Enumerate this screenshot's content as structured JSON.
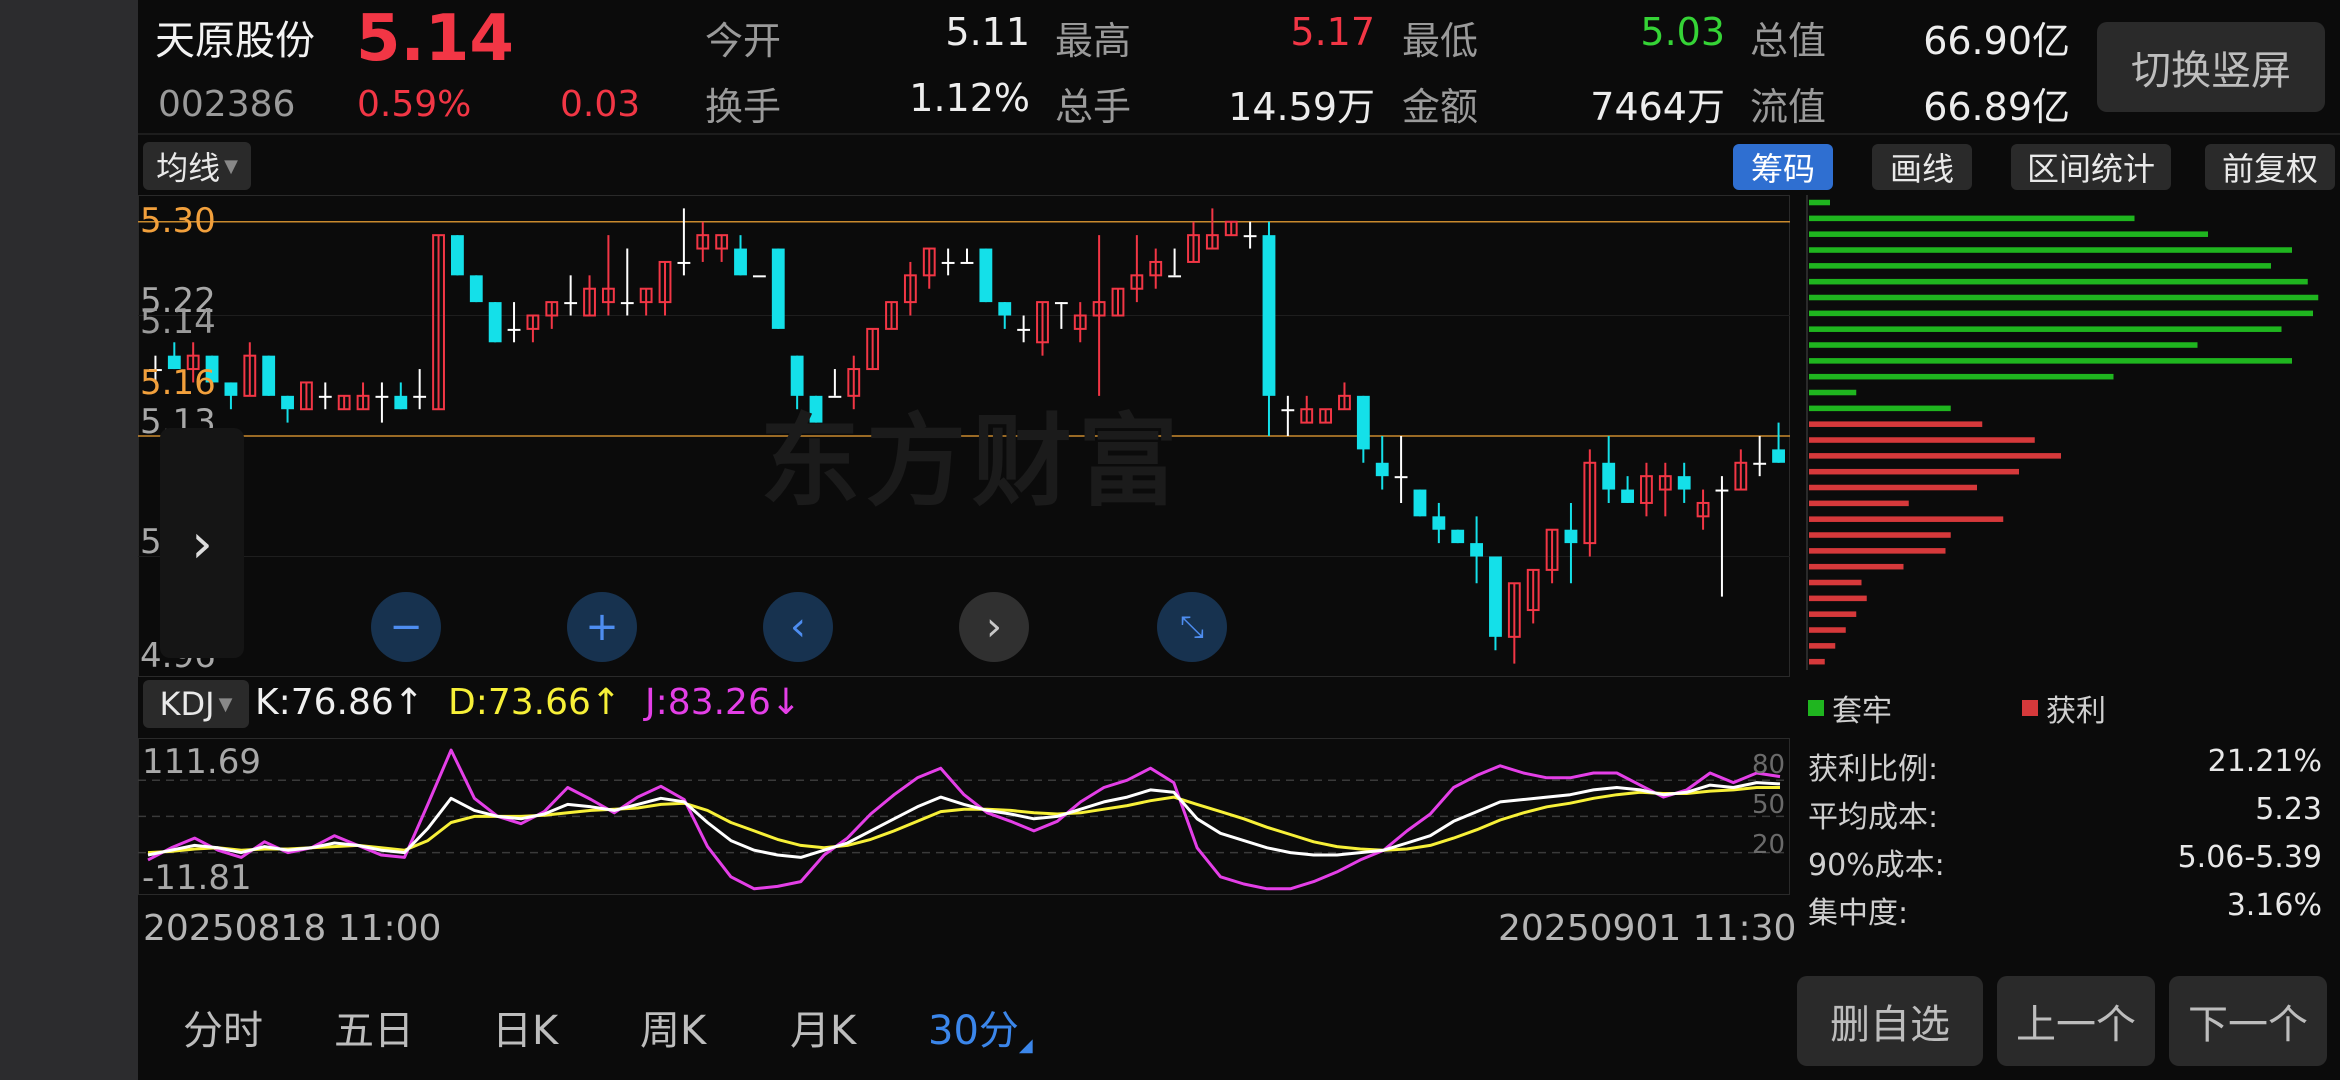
{
  "stock": {
    "name": "天原股份",
    "price": "5.14",
    "code": "002386",
    "change_pct": "0.59%",
    "change": "0.03"
  },
  "quotes": [
    {
      "label": "今开",
      "value": "5.11",
      "color": "white"
    },
    {
      "label": "最高",
      "value": "5.17",
      "color": "red"
    },
    {
      "label": "最低",
      "value": "5.03",
      "color": "green"
    },
    {
      "label": "总值",
      "value": "66.90亿",
      "color": "white"
    },
    {
      "label": "换手",
      "value": "1.12%",
      "color": "white"
    },
    {
      "label": "总手",
      "value": "14.59万",
      "color": "white"
    },
    {
      "label": "金额",
      "value": "7464万",
      "color": "white"
    },
    {
      "label": "流值",
      "value": "66.89亿",
      "color": "white"
    }
  ],
  "switch_button": "切换竖屏",
  "toolbar": {
    "ma_dropdown": "均线",
    "chip": "筹码",
    "draw": "画线",
    "range_stats": "区间统计",
    "adjust": "前复权"
  },
  "price_axis": {
    "labels": [
      "5.30",
      "5.22",
      "5.16",
      "5.13",
      "5.05",
      "4.96"
    ],
    "overlay_label": "5.14"
  },
  "watermark": "东方财富",
  "indicator": {
    "dropdown": "KDJ",
    "k": "K:76.86↑",
    "d": "D:73.66↑",
    "j": "J:83.26↓",
    "ymax": "111.69",
    "ymin": "-11.81",
    "levels": [
      "80",
      "50",
      "20"
    ]
  },
  "dates": {
    "start": "20250818 11:00",
    "end": "20250901 11:30"
  },
  "tabs": [
    "分时",
    "五日",
    "日K",
    "周K",
    "月K",
    "30分"
  ],
  "active_tab": "30分",
  "chip_panel": {
    "legend_trapped": "套牢",
    "legend_profit": "获利",
    "stats": [
      {
        "label": "获利比例:",
        "value": "21.21%"
      },
      {
        "label": "平均成本:",
        "value": "5.23"
      },
      {
        "label": "90%成本:",
        "value": "5.06-5.39"
      },
      {
        "label": "集中度:",
        "value": "3.16%"
      }
    ],
    "green_bars": [
      0.04,
      0.62,
      0.76,
      0.92,
      0.88,
      0.95,
      0.97,
      0.96,
      0.9,
      0.74,
      0.92,
      0.58,
      0.09,
      0.27
    ],
    "red_bars": [
      0.33,
      0.43,
      0.48,
      0.4,
      0.32,
      0.19,
      0.37,
      0.27,
      0.26,
      0.18,
      0.1,
      0.11,
      0.09,
      0.07,
      0.05,
      0.03
    ]
  },
  "bottom_buttons": {
    "delete": "删自选",
    "prev": "上一个",
    "next": "下一个"
  },
  "colors": {
    "up": "#f23645",
    "down": "#14e0e9",
    "accent": "#2f6fd1",
    "k": "#ffffff",
    "d": "#f7f038",
    "j": "#e43fe7",
    "chip_green": "#1fb51f",
    "chip_red": "#d6393b"
  },
  "chart_data": {
    "type": "candlestick",
    "ylim": [
      4.96,
      5.32
    ],
    "reference_lines": [
      5.3,
      5.14
    ],
    "candles": [
      {
        "o": 5.19,
        "h": 5.2,
        "l": 5.18,
        "c": 5.19
      },
      {
        "o": 5.2,
        "h": 5.21,
        "l": 5.19,
        "c": 5.19
      },
      {
        "o": 5.19,
        "h": 5.21,
        "l": 5.18,
        "c": 5.2
      },
      {
        "o": 5.2,
        "h": 5.2,
        "l": 5.18,
        "c": 5.18
      },
      {
        "o": 5.18,
        "h": 5.18,
        "l": 5.16,
        "c": 5.17
      },
      {
        "o": 5.17,
        "h": 5.21,
        "l": 5.17,
        "c": 5.2
      },
      {
        "o": 5.2,
        "h": 5.2,
        "l": 5.17,
        "c": 5.17
      },
      {
        "o": 5.17,
        "h": 5.17,
        "l": 5.15,
        "c": 5.16
      },
      {
        "o": 5.16,
        "h": 5.18,
        "l": 5.16,
        "c": 5.18
      },
      {
        "o": 5.17,
        "h": 5.18,
        "l": 5.16,
        "c": 5.17
      },
      {
        "o": 5.16,
        "h": 5.17,
        "l": 5.16,
        "c": 5.17
      },
      {
        "o": 5.16,
        "h": 5.18,
        "l": 5.16,
        "c": 5.17
      },
      {
        "o": 5.17,
        "h": 5.18,
        "l": 5.15,
        "c": 5.17
      },
      {
        "o": 5.17,
        "h": 5.18,
        "l": 5.16,
        "c": 5.16
      },
      {
        "o": 5.17,
        "h": 5.19,
        "l": 5.16,
        "c": 5.17
      },
      {
        "o": 5.16,
        "h": 5.29,
        "l": 5.16,
        "c": 5.29
      },
      {
        "o": 5.29,
        "h": 5.29,
        "l": 5.26,
        "c": 5.26
      },
      {
        "o": 5.26,
        "h": 5.26,
        "l": 5.24,
        "c": 5.24
      },
      {
        "o": 5.24,
        "h": 5.24,
        "l": 5.21,
        "c": 5.21
      },
      {
        "o": 5.22,
        "h": 5.24,
        "l": 5.21,
        "c": 5.22
      },
      {
        "o": 5.22,
        "h": 5.23,
        "l": 5.21,
        "c": 5.23
      },
      {
        "o": 5.23,
        "h": 5.24,
        "l": 5.22,
        "c": 5.24
      },
      {
        "o": 5.24,
        "h": 5.26,
        "l": 5.23,
        "c": 5.24
      },
      {
        "o": 5.23,
        "h": 5.26,
        "l": 5.23,
        "c": 5.25
      },
      {
        "o": 5.24,
        "h": 5.29,
        "l": 5.23,
        "c": 5.25
      },
      {
        "o": 5.24,
        "h": 5.28,
        "l": 5.23,
        "c": 5.24
      },
      {
        "o": 5.24,
        "h": 5.25,
        "l": 5.23,
        "c": 5.25
      },
      {
        "o": 5.24,
        "h": 5.27,
        "l": 5.23,
        "c": 5.27
      },
      {
        "o": 5.27,
        "h": 5.31,
        "l": 5.26,
        "c": 5.27
      },
      {
        "o": 5.28,
        "h": 5.3,
        "l": 5.27,
        "c": 5.29
      },
      {
        "o": 5.28,
        "h": 5.29,
        "l": 5.27,
        "c": 5.29
      },
      {
        "o": 5.28,
        "h": 5.29,
        "l": 5.26,
        "c": 5.26
      },
      {
        "o": 5.26,
        "h": 5.26,
        "l": 5.26,
        "c": 5.26
      },
      {
        "o": 5.28,
        "h": 5.28,
        "l": 5.22,
        "c": 5.22
      },
      {
        "o": 5.2,
        "h": 5.2,
        "l": 5.16,
        "c": 5.17
      },
      {
        "o": 5.17,
        "h": 5.17,
        "l": 5.15,
        "c": 5.15
      },
      {
        "o": 5.17,
        "h": 5.19,
        "l": 5.17,
        "c": 5.17
      },
      {
        "o": 5.17,
        "h": 5.2,
        "l": 5.16,
        "c": 5.19
      },
      {
        "o": 5.19,
        "h": 5.22,
        "l": 5.19,
        "c": 5.22
      },
      {
        "o": 5.22,
        "h": 5.24,
        "l": 5.22,
        "c": 5.24
      },
      {
        "o": 5.24,
        "h": 5.27,
        "l": 5.23,
        "c": 5.26
      },
      {
        "o": 5.26,
        "h": 5.28,
        "l": 5.25,
        "c": 5.28
      },
      {
        "o": 5.27,
        "h": 5.28,
        "l": 5.26,
        "c": 5.27
      },
      {
        "o": 5.27,
        "h": 5.28,
        "l": 5.27,
        "c": 5.27
      },
      {
        "o": 5.28,
        "h": 5.28,
        "l": 5.24,
        "c": 5.24
      },
      {
        "o": 5.24,
        "h": 5.24,
        "l": 5.22,
        "c": 5.23
      },
      {
        "o": 5.22,
        "h": 5.23,
        "l": 5.21,
        "c": 5.22
      },
      {
        "o": 5.21,
        "h": 5.24,
        "l": 5.2,
        "c": 5.24
      },
      {
        "o": 5.24,
        "h": 5.24,
        "l": 5.22,
        "c": 5.24
      },
      {
        "o": 5.22,
        "h": 5.24,
        "l": 5.21,
        "c": 5.23
      },
      {
        "o": 5.23,
        "h": 5.29,
        "l": 5.17,
        "c": 5.24
      },
      {
        "o": 5.23,
        "h": 5.25,
        "l": 5.23,
        "c": 5.25
      },
      {
        "o": 5.25,
        "h": 5.29,
        "l": 5.24,
        "c": 5.26
      },
      {
        "o": 5.26,
        "h": 5.28,
        "l": 5.25,
        "c": 5.27
      },
      {
        "o": 5.26,
        "h": 5.28,
        "l": 5.26,
        "c": 5.26
      },
      {
        "o": 5.27,
        "h": 5.3,
        "l": 5.27,
        "c": 5.29
      },
      {
        "o": 5.28,
        "h": 5.31,
        "l": 5.28,
        "c": 5.29
      },
      {
        "o": 5.29,
        "h": 5.3,
        "l": 5.29,
        "c": 5.3
      },
      {
        "o": 5.29,
        "h": 5.3,
        "l": 5.28,
        "c": 5.29
      },
      {
        "o": 5.29,
        "h": 5.3,
        "l": 5.14,
        "c": 5.17
      },
      {
        "o": 5.16,
        "h": 5.17,
        "l": 5.14,
        "c": 5.16
      },
      {
        "o": 5.15,
        "h": 5.17,
        "l": 5.15,
        "c": 5.16
      },
      {
        "o": 5.15,
        "h": 5.16,
        "l": 5.15,
        "c": 5.16
      },
      {
        "o": 5.16,
        "h": 5.18,
        "l": 5.16,
        "c": 5.17
      },
      {
        "o": 5.17,
        "h": 5.17,
        "l": 5.12,
        "c": 5.13
      },
      {
        "o": 5.12,
        "h": 5.14,
        "l": 5.1,
        "c": 5.11
      },
      {
        "o": 5.11,
        "h": 5.14,
        "l": 5.09,
        "c": 5.11
      },
      {
        "o": 5.1,
        "h": 5.1,
        "l": 5.08,
        "c": 5.08
      },
      {
        "o": 5.08,
        "h": 5.09,
        "l": 5.06,
        "c": 5.07
      },
      {
        "o": 5.07,
        "h": 5.07,
        "l": 5.06,
        "c": 5.06
      },
      {
        "o": 5.06,
        "h": 5.08,
        "l": 5.03,
        "c": 5.05
      },
      {
        "o": 5.05,
        "h": 5.05,
        "l": 4.98,
        "c": 4.99
      },
      {
        "o": 4.99,
        "h": 5.03,
        "l": 4.97,
        "c": 5.03
      },
      {
        "o": 5.01,
        "h": 5.04,
        "l": 5.0,
        "c": 5.04
      },
      {
        "o": 5.04,
        "h": 5.07,
        "l": 5.03,
        "c": 5.07
      },
      {
        "o": 5.07,
        "h": 5.09,
        "l": 5.03,
        "c": 5.06
      },
      {
        "o": 5.06,
        "h": 5.13,
        "l": 5.05,
        "c": 5.12
      },
      {
        "o": 5.12,
        "h": 5.14,
        "l": 5.09,
        "c": 5.1
      },
      {
        "o": 5.1,
        "h": 5.11,
        "l": 5.09,
        "c": 5.09
      },
      {
        "o": 5.09,
        "h": 5.12,
        "l": 5.08,
        "c": 5.11
      },
      {
        "o": 5.1,
        "h": 5.12,
        "l": 5.08,
        "c": 5.11
      },
      {
        "o": 5.11,
        "h": 5.12,
        "l": 5.09,
        "c": 5.1
      },
      {
        "o": 5.08,
        "h": 5.1,
        "l": 5.07,
        "c": 5.09
      },
      {
        "o": 5.1,
        "h": 5.11,
        "l": 5.02,
        "c": 5.1
      },
      {
        "o": 5.1,
        "h": 5.13,
        "l": 5.1,
        "c": 5.12
      },
      {
        "o": 5.12,
        "h": 5.14,
        "l": 5.11,
        "c": 5.12
      },
      {
        "o": 5.13,
        "h": 5.15,
        "l": 5.12,
        "c": 5.12
      }
    ],
    "kdj": {
      "ylim": [
        -11.81,
        111.69
      ],
      "k": [
        18,
        22,
        26,
        24,
        20,
        25,
        22,
        24,
        28,
        26,
        22,
        20,
        40,
        65,
        55,
        50,
        48,
        52,
        60,
        58,
        55,
        60,
        65,
        62,
        45,
        30,
        22,
        18,
        16,
        22,
        28,
        38,
        48,
        58,
        66,
        60,
        55,
        52,
        48,
        50,
        56,
        62,
        66,
        72,
        70,
        48,
        36,
        30,
        24,
        20,
        18,
        18,
        20,
        22,
        28,
        34,
        46,
        54,
        62,
        64,
        66,
        68,
        72,
        74,
        72,
        68,
        70,
        76,
        74,
        78,
        77
      ],
      "d": [
        20,
        21,
        23,
        24,
        22,
        23,
        23,
        24,
        25,
        26,
        24,
        22,
        30,
        45,
        50,
        50,
        50,
        51,
        53,
        55,
        56,
        57,
        60,
        61,
        55,
        45,
        38,
        31,
        26,
        24,
        26,
        31,
        38,
        46,
        54,
        56,
        56,
        55,
        53,
        52,
        53,
        56,
        59,
        63,
        66,
        60,
        54,
        48,
        41,
        35,
        29,
        25,
        23,
        22,
        23,
        26,
        32,
        39,
        47,
        53,
        58,
        61,
        65,
        68,
        70,
        69,
        69,
        71,
        72,
        74,
        74
      ],
      "j": [
        14,
        24,
        32,
        22,
        16,
        29,
        20,
        24,
        34,
        26,
        18,
        16,
        60,
        105,
        65,
        50,
        44,
        54,
        74,
        64,
        53,
        66,
        75,
        64,
        25,
        0,
        -10,
        -8,
        -4,
        18,
        32,
        52,
        68,
        82,
        90,
        68,
        53,
        46,
        38,
        46,
        62,
        74,
        80,
        90,
        78,
        24,
        0,
        -6,
        -10,
        -10,
        -4,
        4,
        14,
        22,
        38,
        52,
        74,
        84,
        92,
        86,
        82,
        82,
        86,
        86,
        76,
        66,
        72,
        86,
        78,
        86,
        83
      ]
    }
  }
}
